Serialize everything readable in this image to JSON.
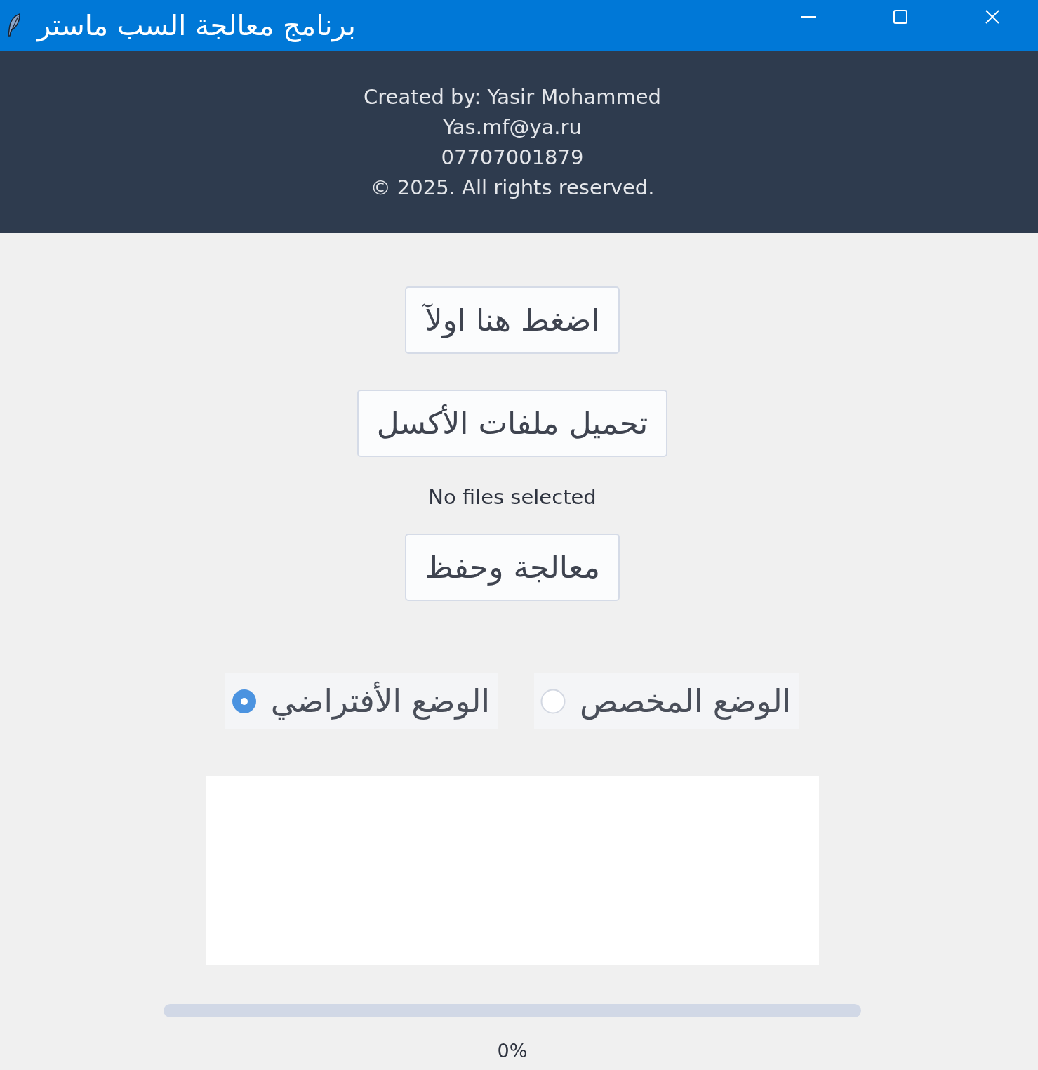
{
  "window": {
    "title": "برنامج معالجة السب ماستر"
  },
  "credits": [
    "Created by: Yasir Mohammed",
    "Yas.mf@ya.ru",
    "07707001879",
    "© 2025. All rights reserved."
  ],
  "buttons_top": [
    {
      "label": "اضغط هنا اولآ"
    },
    {
      "label": "تحميل ملفات الأكسل"
    }
  ],
  "file_status": "No files selected",
  "buttons_bottom": [
    {
      "label": "معالجة وحفظ"
    }
  ],
  "modes": [
    {
      "label": "الوضع المخصص",
      "selected": false
    },
    {
      "label": "الوضع الأفتراضي",
      "selected": true
    }
  ],
  "progress": {
    "level": 0,
    "reading": "0%"
  }
}
